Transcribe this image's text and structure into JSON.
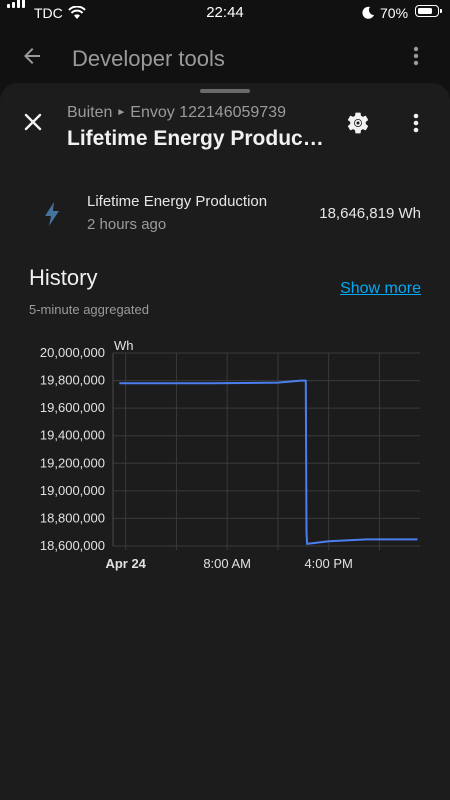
{
  "status_bar": {
    "carrier": "TDC",
    "time": "22:44",
    "battery_percent": "70%",
    "battery_level": 0.7,
    "icons": [
      "signal-icon",
      "wifi-icon",
      "do-not-disturb-moon-icon",
      "battery-icon"
    ]
  },
  "app_bar": {
    "title": "Developer tools",
    "back_icon": "arrow-left-icon",
    "menu_icon": "more-vertical-icon"
  },
  "dialog": {
    "breadcrumb_area": "Buiten",
    "breadcrumb_device": "Envoy 122146059739",
    "title": "Lifetime Energy Produc…",
    "icons": [
      "close-icon",
      "gear-icon",
      "more-vertical-icon"
    ]
  },
  "state": {
    "icon": "lightning-bolt-icon",
    "name": "Lifetime Energy Production",
    "last_changed": "2 hours ago",
    "value": "18,646,819 Wh"
  },
  "history": {
    "title": "History",
    "subtitle": "5-minute aggregated",
    "show_more": "Show more"
  },
  "colors": {
    "accent": "#03a9f4",
    "line": "#4a7ff0",
    "icon_bolt": "#44739e",
    "sheet_bg": "#1c1c1c",
    "page_bg": "#111111"
  },
  "chart_data": {
    "type": "line",
    "ylabel": "Wh",
    "ylim": [
      18600000,
      20000000
    ],
    "y_ticks": [
      "20,000,000",
      "19,800,000",
      "19,600,000",
      "19,400,000",
      "19,200,000",
      "19,000,000",
      "18,800,000",
      "18,600,000"
    ],
    "x_ticks": [
      "Apr 24",
      "8:00 AM",
      "4:00 PM"
    ],
    "grid": true,
    "series": [
      {
        "x_hours": [
          -0.5,
          7,
          12,
          13.8,
          14.2,
          14.25,
          14.3,
          16,
          19,
          23
        ],
        "values": [
          19780000,
          19780000,
          19785000,
          19800000,
          19800000,
          18700000,
          18615000,
          18635000,
          18648000,
          18648000
        ]
      }
    ]
  }
}
